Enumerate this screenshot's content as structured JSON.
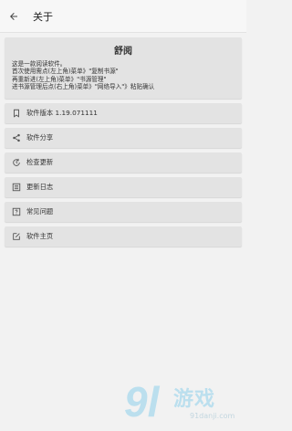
{
  "appbar": {
    "title": "关于"
  },
  "about": {
    "app_name": "舒阅",
    "lines": [
      "这是一款阅读软件。",
      "首次使用需点(左上角)菜单》\"复制书源\"",
      "再重新进(左上角)菜单》\"书源管理\"",
      "进书源管理后点(右上角)菜单》\"网络导入\"》粘贴确认"
    ]
  },
  "items": [
    {
      "label": "软件版本 1.19.071111",
      "icon": "bookmark-icon"
    },
    {
      "label": "软件分享",
      "icon": "share-icon"
    },
    {
      "label": "检查更新",
      "icon": "update-icon"
    },
    {
      "label": "更新日志",
      "icon": "changelog-icon"
    },
    {
      "label": "常见问题",
      "icon": "help-icon"
    },
    {
      "label": "软件主页",
      "icon": "edit-icon"
    }
  ],
  "watermark": {
    "brand": "9l",
    "name": "游戏",
    "url": "91danji.com"
  },
  "colors": {
    "background": "#f2f2f2",
    "card": "#e3e3e3",
    "watermark": "#8fd1ec"
  }
}
